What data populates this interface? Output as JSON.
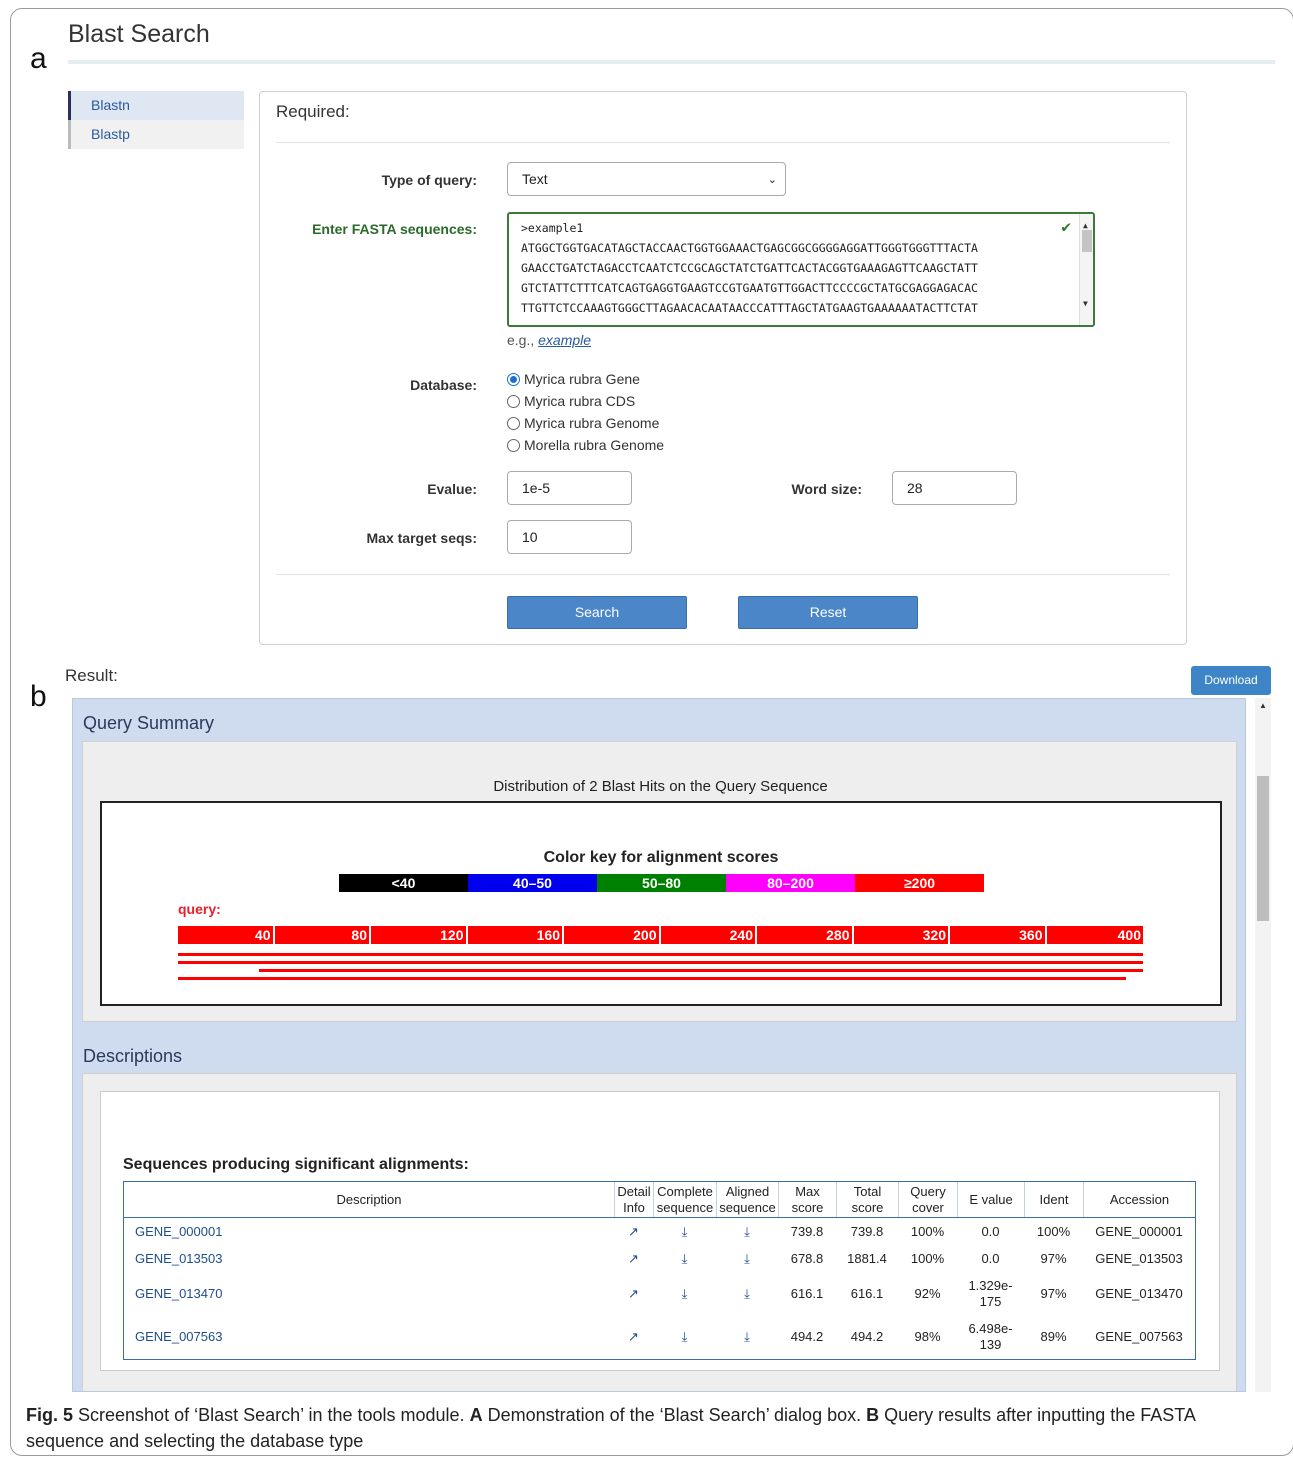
{
  "panel_a_letter": "a",
  "panel_b_letter": "b",
  "page_title": "Blast Search",
  "sidebar": {
    "items": [
      {
        "label": "Blastn"
      },
      {
        "label": "Blastp"
      }
    ]
  },
  "form": {
    "required_label": "Required:",
    "type_of_query_label": "Type of query:",
    "type_of_query_value": "Text",
    "fasta_label": "Enter FASTA sequences:",
    "fasta_lines": [
      ">example1",
      "ATGGCTGGTGACATAGCTACCAACTGGTGGAAACTGAGCGGCGGGGAGGATTGGGTGGGTTTACTA",
      "GAACCTGATCTAGACCTCAATCTCCGCAGCTATCTGATTCACTACGGTGAAAGAGTTCAAGCTATT",
      "GTCTATTCTTTCATCAGTGAGGTGAAGTCCGTGAATGTTGGACTTCCCCGCTATGCGAGGAGACAC",
      "TTGTTCTCCAAAGTGGGCTTAGAACACAATAACCCATTTAGCTATGAAGTGAAAAAATACTTCTAT"
    ],
    "example_prefix": "e.g.,",
    "example_link": " example",
    "database_label": "Database:",
    "database_options": [
      "Myrica rubra Gene",
      "Myrica rubra CDS",
      "Myrica rubra Genome",
      "Morella rubra Genome"
    ],
    "evalue_label": "Evalue:",
    "evalue_value": "1e-5",
    "word_size_label": "Word size:",
    "word_size_value": "28",
    "max_target_label": "Max target seqs:",
    "max_target_value": "10",
    "search_button": "Search",
    "reset_button": "Reset"
  },
  "result": {
    "label": "Result:",
    "download_button": "Download",
    "query_summary_title": "Query Summary",
    "distribution_title": "Distribution of 2 Blast Hits on the Query Sequence",
    "color_key_title": "Color key for alignment scores",
    "color_keys": [
      {
        "label": "<40",
        "color": "#000000"
      },
      {
        "label": "40–50",
        "color": "#0000ee"
      },
      {
        "label": "50–80",
        "color": "#008000"
      },
      {
        "label": "80–200",
        "color": "#ff00ff"
      },
      {
        "label": "≥200",
        "color": "#ff0000"
      }
    ],
    "query_label": "query:",
    "ruler_ticks": [
      "40",
      "80",
      "120",
      "160",
      "200",
      "240",
      "280",
      "320",
      "360",
      "400"
    ],
    "descriptions_title": "Descriptions",
    "sig_title": "Sequences producing significant alignments:",
    "columns": [
      "Description",
      "Detail Info",
      "Complete sequence",
      "Aligned sequence",
      "Max score",
      "Total score",
      "Query cover",
      "E value",
      "Ident",
      "Accession"
    ],
    "rows": [
      {
        "description": "GENE_000001",
        "max_score": "739.8",
        "total_score": "739.8",
        "query_cover": "100%",
        "evalue": "0.0",
        "ident": "100%",
        "accession": "GENE_000001"
      },
      {
        "description": "GENE_013503",
        "max_score": "678.8",
        "total_score": "1881.4",
        "query_cover": "100%",
        "evalue": "0.0",
        "ident": "97%",
        "accession": "GENE_013503"
      },
      {
        "description": "GENE_013470",
        "max_score": "616.1",
        "total_score": "616.1",
        "query_cover": "92%",
        "evalue": "1.329e-175",
        "ident": "97%",
        "accession": "GENE_013470"
      },
      {
        "description": "GENE_007563",
        "max_score": "494.2",
        "total_score": "494.2",
        "query_cover": "98%",
        "evalue": "6.498e-139",
        "ident": "89%",
        "accession": "GENE_007563"
      }
    ]
  },
  "caption": {
    "fig": "Fig. 5",
    "text1": " Screenshot of ‘Blast Search’ in the tools module. ",
    "a": "A",
    "text2": " Demonstration of the ‘Blast Search’ dialog box. ",
    "b": "B",
    "text3": " Query results after inputting the FASTA sequence and selecting the database type"
  }
}
